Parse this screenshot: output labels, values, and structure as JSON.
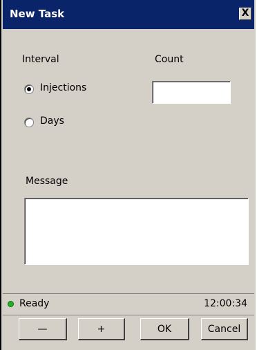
{
  "window": {
    "title": "New Task",
    "close_glyph": "X"
  },
  "form": {
    "interval_label": "Interval",
    "count_label": "Count",
    "options": [
      {
        "label": "Injections",
        "selected": true
      },
      {
        "label": "Days",
        "selected": false
      }
    ],
    "count_value": "",
    "message_label": "Message",
    "message_value": ""
  },
  "status": {
    "text": "Ready",
    "time": "12:00:34",
    "indicator_color": "#24b024"
  },
  "buttons": {
    "minus": "—",
    "plus": "+",
    "ok": "OK",
    "cancel": "Cancel"
  }
}
